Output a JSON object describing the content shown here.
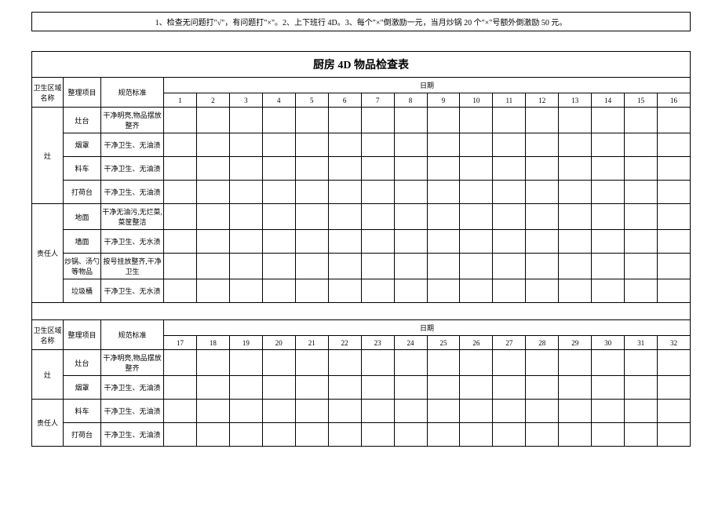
{
  "note": "1、检查无问题打\"√\"，有问题打\"×\"。2、上下班行 4D。3、每个\"×\"倒激励一元，当月炒锅 20 个\"×\"号额外倒激励 50 元。",
  "title": "厨房 4D 物品检查表",
  "headers": {
    "area": "卫生区域名称",
    "item": "整理项目",
    "standard": "规范标准",
    "date": "日期"
  },
  "days_set1": [
    "1",
    "2",
    "3",
    "4",
    "5",
    "6",
    "7",
    "8",
    "9",
    "10",
    "11",
    "12",
    "13",
    "14",
    "15",
    "16"
  ],
  "days_set2": [
    "17",
    "18",
    "19",
    "20",
    "21",
    "22",
    "23",
    "24",
    "25",
    "26",
    "27",
    "28",
    "29",
    "30",
    "31",
    "32"
  ],
  "area_labels": {
    "zao": "灶",
    "person": "责任人"
  },
  "rows1": [
    {
      "item": "灶台",
      "std": "干净明亮,物品摆放整齐"
    },
    {
      "item": "烟罩",
      "std": "干净卫生、无油渍"
    },
    {
      "item": "料车",
      "std": "干净卫生、无油渍"
    },
    {
      "item": "打荷台",
      "std": "干净卫生、无油渍"
    },
    {
      "item": "地面",
      "std": "干净无油污,无烂菜,菜筐整洁"
    },
    {
      "item": "墙面",
      "std": "干净卫生、无水渍"
    },
    {
      "item": "炒锅、汤勺等物品",
      "std": "按号挂放整齐,干净卫生"
    },
    {
      "item": "垃圾桶",
      "std": "干净卫生、无水渍"
    }
  ],
  "rows2": [
    {
      "item": "灶台",
      "std": "干净明亮,物品摆放整齐"
    },
    {
      "item": "烟罩",
      "std": "干净卫生、无油渍"
    },
    {
      "item": "料车",
      "std": "干净卫生、无油渍"
    },
    {
      "item": "打荷台",
      "std": "干净卫生、无油渍"
    }
  ]
}
